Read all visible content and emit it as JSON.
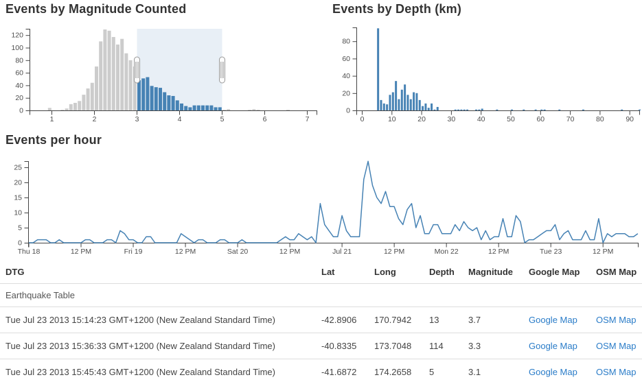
{
  "colors": {
    "accent": "#4682b4",
    "deselected": "#cccccc",
    "axis": "#444444",
    "tick_text": "#4d4d4d",
    "title": "#333333",
    "link": "#2a7cc8",
    "row_border": "#dddddd",
    "brush_fill_opacity": "0.125"
  },
  "chart_data": [
    {
      "type": "bar",
      "title": "Events by Magnitude Counted",
      "bin_width": 0.1,
      "xlim": [
        0.5,
        7.25
      ],
      "ylim": [
        0,
        130
      ],
      "x_ticks": [
        1,
        2,
        3,
        4,
        5,
        6,
        7
      ],
      "y_ticks": [
        0,
        20,
        40,
        60,
        80,
        100,
        120
      ],
      "selection": {
        "from": 3.0,
        "to": 5.0
      },
      "x": [
        0.9,
        1.2,
        1.3,
        1.4,
        1.5,
        1.6,
        1.7,
        1.8,
        1.9,
        2.0,
        2.1,
        2.2,
        2.3,
        2.4,
        2.5,
        2.6,
        2.7,
        2.8,
        2.9,
        3.0,
        3.1,
        3.2,
        3.3,
        3.4,
        3.5,
        3.6,
        3.7,
        3.8,
        3.9,
        4.0,
        4.1,
        4.2,
        4.3,
        4.4,
        4.5,
        4.6,
        4.7,
        4.8,
        4.9,
        5.0,
        5.1,
        5.6,
        5.7,
        5.8,
        6.5
      ],
      "y": [
        4,
        1,
        3,
        10,
        12,
        15,
        25,
        35,
        44,
        70,
        110,
        129,
        127,
        117,
        105,
        114,
        91,
        80,
        70,
        48,
        51,
        53,
        39,
        37,
        36,
        29,
        24,
        23,
        16,
        11,
        7,
        5,
        8,
        8,
        8,
        8,
        8,
        5,
        5,
        1,
        2,
        1,
        2,
        1,
        1
      ]
    },
    {
      "type": "bar",
      "title": "Events by Depth (km)",
      "bin_width": 1,
      "xlim": [
        0,
        93
      ],
      "ylim": [
        0,
        95
      ],
      "x_ticks": [
        0,
        10,
        20,
        30,
        40,
        50,
        60,
        70,
        80,
        90
      ],
      "y_ticks": [
        0,
        20,
        40,
        60,
        80
      ],
      "x": [
        5,
        6,
        7,
        8,
        9,
        10,
        11,
        12,
        13,
        14,
        15,
        16,
        17,
        18,
        19,
        20,
        21,
        22,
        23,
        24,
        25,
        31,
        32,
        33,
        34,
        35,
        38,
        39,
        40,
        45,
        50,
        54,
        58,
        60,
        61,
        66,
        74,
        87,
        93
      ],
      "y": [
        95,
        12,
        8,
        7,
        18,
        21,
        34,
        13,
        24,
        30,
        18,
        13,
        21,
        20,
        12,
        5,
        8,
        3,
        8,
        1,
        4,
        1,
        1,
        1,
        1,
        1,
        1,
        1,
        2,
        1,
        1,
        1,
        1,
        1,
        1,
        1,
        1,
        1,
        1
      ]
    },
    {
      "type": "line",
      "title": "Events per hour",
      "ylim": [
        0,
        27
      ],
      "y_ticks": [
        0,
        5,
        10,
        15,
        20,
        25
      ],
      "x_tick_labels": [
        "Thu 18",
        "12 PM",
        "Fri 19",
        "12 PM",
        "Sat 20",
        "12 PM",
        "Jul 21",
        "12 PM",
        "Mon 22",
        "12 PM",
        "Tue 23",
        "12 PM"
      ],
      "x_tick_hours": [
        0,
        12,
        24,
        36,
        48,
        60,
        72,
        84,
        96,
        108,
        120,
        132
      ],
      "interval_hours": 1,
      "values": [
        0,
        0,
        1,
        1,
        1,
        0,
        0,
        1,
        0,
        0,
        0,
        0,
        0,
        1,
        1,
        0,
        0,
        0,
        1,
        1,
        0,
        4,
        3,
        1,
        1,
        0,
        0,
        2,
        2,
        0,
        0,
        0,
        0,
        0,
        0,
        3,
        2,
        1,
        0,
        1,
        1,
        0,
        0,
        0,
        1,
        1,
        0,
        0,
        0,
        1,
        0,
        0,
        0,
        0,
        0,
        0,
        0,
        0,
        1,
        2,
        1,
        1,
        3,
        2,
        1,
        2,
        0,
        13,
        6,
        4,
        2,
        2,
        9,
        4,
        2,
        2,
        2,
        21,
        27,
        19,
        15,
        13,
        17,
        12,
        12,
        8,
        6,
        11,
        13,
        5,
        9,
        3,
        3,
        6,
        6,
        3,
        3,
        3,
        6,
        4,
        7,
        5,
        4,
        5,
        1,
        4,
        1,
        2,
        2,
        8,
        2,
        2,
        9,
        7,
        0,
        1,
        1,
        2,
        3,
        4,
        4,
        6,
        1,
        3,
        4,
        1,
        1,
        1,
        4,
        1,
        1,
        8,
        0,
        3,
        2,
        3,
        3,
        3,
        2,
        2,
        3
      ]
    }
  ],
  "table": {
    "caption": "Earthquake Table",
    "headers": [
      "DTG",
      "Lat",
      "Long",
      "Depth",
      "Magnitude",
      "Google Map",
      "OSM Map"
    ],
    "rows": [
      {
        "dtg": "Tue Jul 23 2013 15:14:23 GMT+1200 (New Zealand Standard Time)",
        "lat": "-42.8906",
        "long": "170.7942",
        "depth": "13",
        "magnitude": "3.7",
        "google_map": "Google Map",
        "osm_map": "OSM Map"
      },
      {
        "dtg": "Tue Jul 23 2013 15:36:33 GMT+1200 (New Zealand Standard Time)",
        "lat": "-40.8335",
        "long": "173.7048",
        "depth": "114",
        "magnitude": "3.3",
        "google_map": "Google Map",
        "osm_map": "OSM Map"
      },
      {
        "dtg": "Tue Jul 23 2013 15:45:43 GMT+1200 (New Zealand Standard Time)",
        "lat": "-41.6872",
        "long": "174.2658",
        "depth": "5",
        "magnitude": "3.1",
        "google_map": "Google Map",
        "osm_map": "OSM Map"
      }
    ]
  }
}
